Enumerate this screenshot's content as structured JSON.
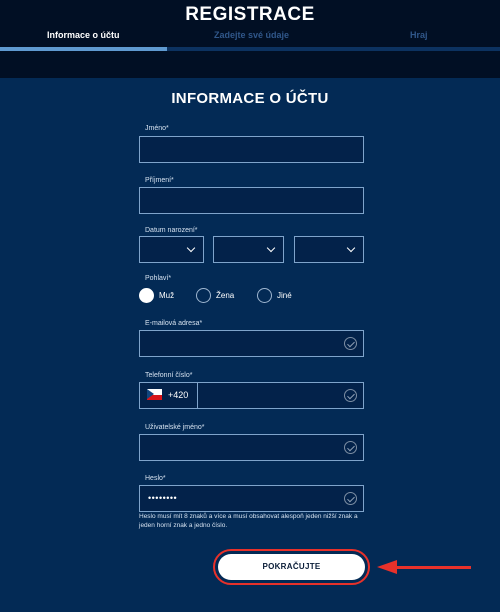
{
  "header": {
    "title": "REGISTRACE",
    "steps": [
      {
        "label": "Informace o účtu",
        "active": true
      },
      {
        "label": "Zadejte své údaje",
        "active": false
      },
      {
        "label": "Hraj",
        "active": false
      }
    ],
    "progress": 0.333
  },
  "form": {
    "title": "INFORMACE O ÚČTU",
    "first_name": {
      "label": "Jméno*",
      "value": ""
    },
    "last_name": {
      "label": "Příjmení*",
      "value": ""
    },
    "birth_date": {
      "label": "Datum narození*",
      "day": "",
      "month": "",
      "year": ""
    },
    "gender": {
      "label": "Pohlaví*",
      "options": [
        {
          "label": "Muž",
          "selected": true
        },
        {
          "label": "Žena",
          "selected": false
        },
        {
          "label": "Jiné",
          "selected": false
        }
      ]
    },
    "email": {
      "label": "E-mailová adresa*",
      "value": ""
    },
    "phone": {
      "label": "Telefonní číslo*",
      "country_code": "+420",
      "value": ""
    },
    "username": {
      "label": "Uživatelské jméno*",
      "value": ""
    },
    "password": {
      "label": "Heslo*",
      "masked_value": "••••••••",
      "hint": "Heslo musí mít 8 znaků a více a musí obsahovat alespoň jeden nižší znak a jeden horní znak a jedno číslo."
    },
    "submit_label": "POKRAČUJTE"
  },
  "colors": {
    "background": "#032a55",
    "header_bg": "#010f24",
    "accent_red": "#e8312a",
    "progress": "#5f9ad1"
  }
}
